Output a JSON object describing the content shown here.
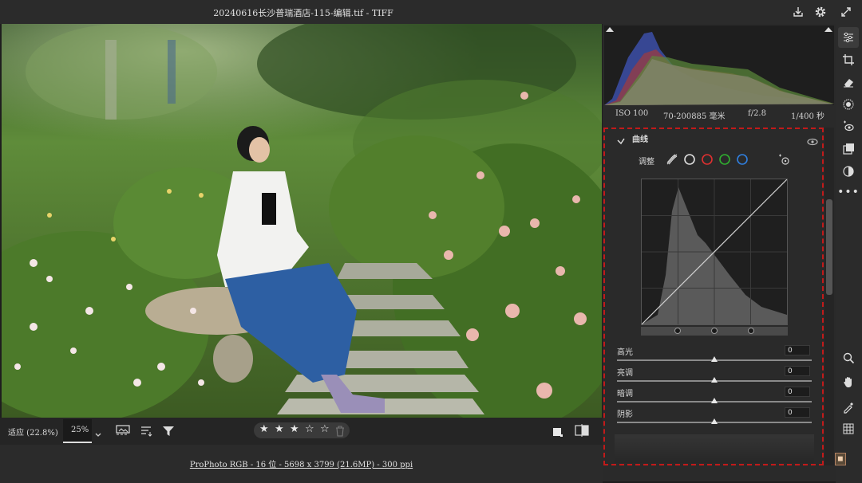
{
  "window": {
    "title": "20240616长沙普瑞酒店-115-编辑.tif -  TIFF"
  },
  "histogram": {
    "iso": "ISO 100",
    "lens": "70-200885 毫米",
    "aperture": "f/2.8",
    "shutter": "1/400 秒"
  },
  "curve_panel": {
    "section_title": "曲线",
    "adjust_label": "调整",
    "sliders": [
      {
        "label": "高光",
        "value": "0"
      },
      {
        "label": "亮调",
        "value": "0"
      },
      {
        "label": "暗调",
        "value": "0"
      },
      {
        "label": "阴影",
        "value": "0"
      }
    ],
    "channel_colors": [
      "#e0e0e0",
      "#e03030",
      "#30b030",
      "#3080e0"
    ]
  },
  "bottom": {
    "fit_label": "适应 (22.8%)",
    "zoom_value": "25%",
    "stars_filled": 3,
    "stars_total": 5,
    "file_info": "ProPhoto RGB - 16 位 - 5698 x 3799 (21.6MP) - 300 ppi"
  },
  "icons": {
    "title_right": [
      "download-icon",
      "gear-icon",
      "expand-icon"
    ],
    "tools": [
      "sliders-icon",
      "crop-icon",
      "eraser-icon",
      "mask-icon",
      "redeye-icon",
      "presets-icon",
      "snapshots-icon",
      "more-icon",
      "zoom-icon",
      "hand-icon",
      "eyedropper-icon",
      "grid-icon"
    ]
  }
}
